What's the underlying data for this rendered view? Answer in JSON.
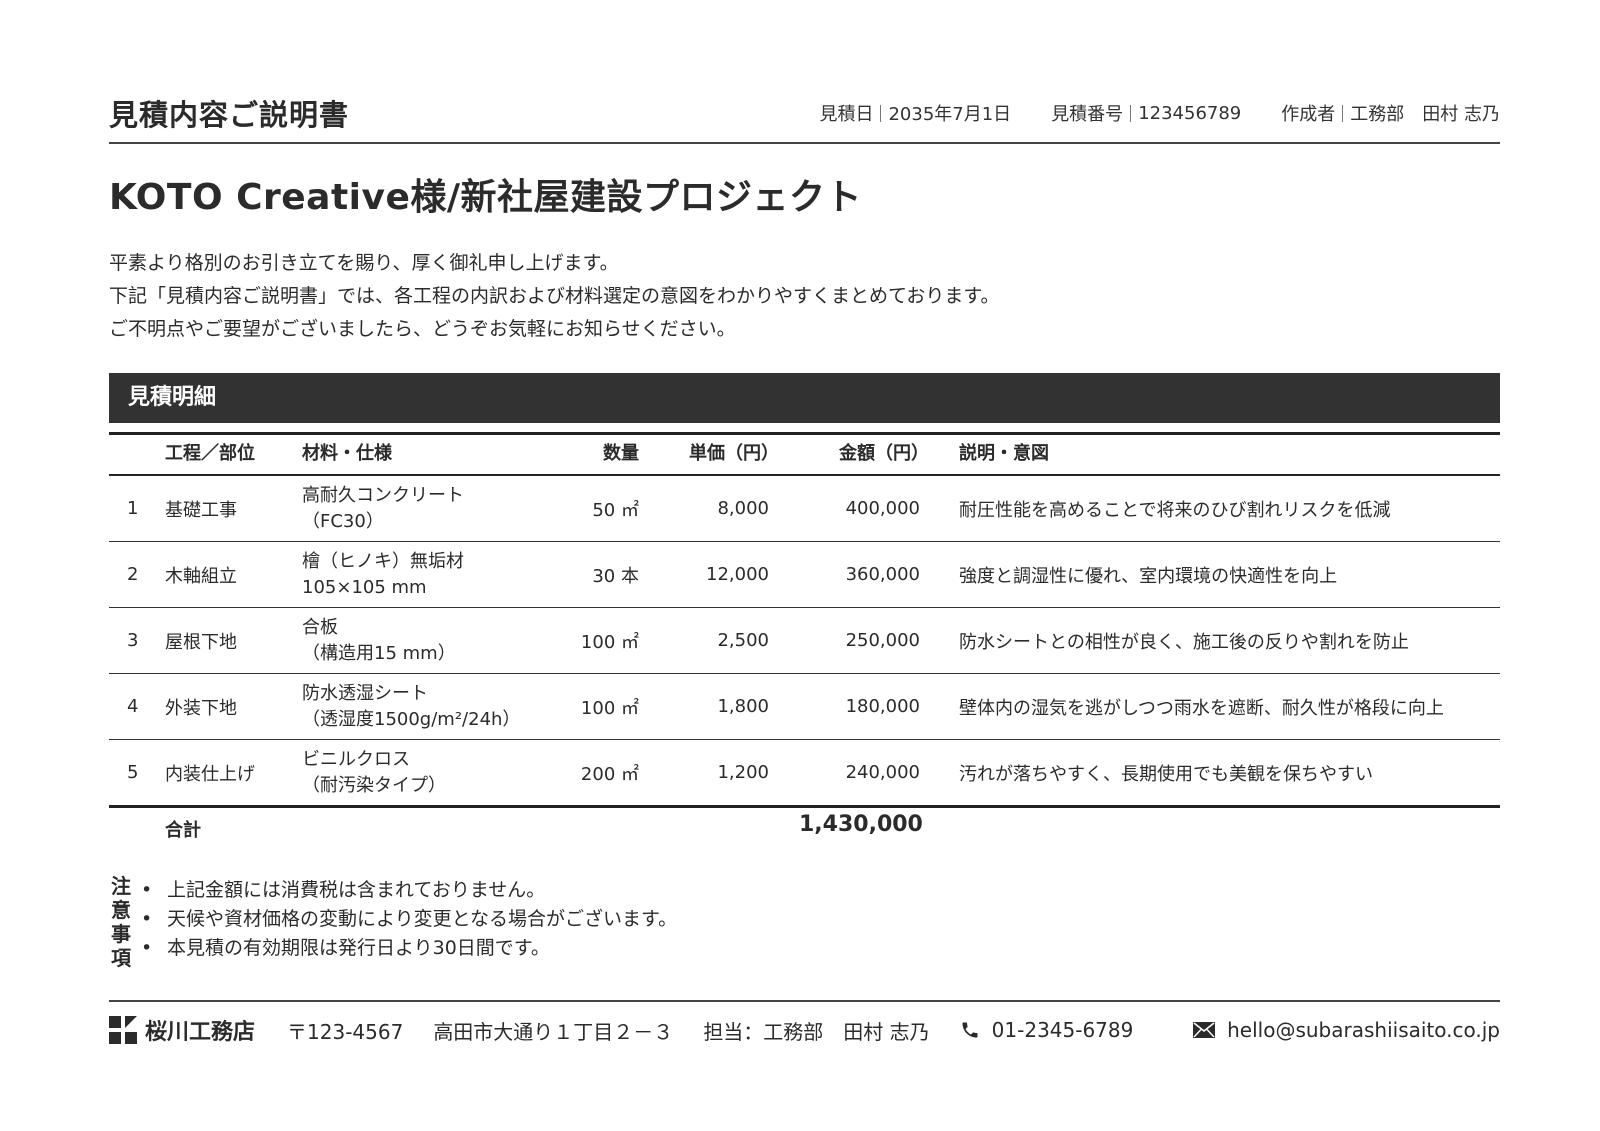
{
  "header": {
    "title": "見積内容ご説明書",
    "meta": [
      {
        "label": "見積日",
        "value": "2035年7月1日"
      },
      {
        "label": "見積番号",
        "value": "123456789"
      },
      {
        "label": "作成者",
        "value": "工務部　田村 志乃"
      }
    ]
  },
  "project_title": "KOTO Creative様/新社屋建設プロジェクト",
  "intro": [
    "平素より格別のお引き立てを賜り、厚く御礼申し上げます。",
    "下記「見積内容ご説明書」では、各工程の内訳および材料選定の意図をわかりやすくまとめております。",
    "ご不明点やご要望がございましたら、どうぞお気軽にお知らせください。"
  ],
  "section_title": "見積明細",
  "table": {
    "headers": {
      "process": "工程／部位",
      "material": "材料・仕様",
      "qty": "数量",
      "unit_price": "単価（円）",
      "amount": "金額（円）",
      "description": "説明・意図"
    },
    "rows": [
      {
        "no": "1",
        "process": "基礎工事",
        "material1": "高耐久コンクリート",
        "material2": "（FC30）",
        "qty": "50 ㎡",
        "unit_price": "8,000",
        "amount": "400,000",
        "description": "耐圧性能を高めることで将来のひび割れリスクを低減"
      },
      {
        "no": "2",
        "process": "木軸組立",
        "material1": "檜（ヒノキ）無垢材",
        "material2": " 105×105 mm",
        "qty": "30 本",
        "unit_price": "12,000",
        "amount": "360,000",
        "description": "強度と調湿性に優れ、室内環境の快適性を向上"
      },
      {
        "no": "3",
        "process": "屋根下地",
        "material1": "合板",
        "material2": "（構造用15 mm）",
        "qty": "100 ㎡",
        "unit_price": "2,500",
        "amount": "250,000",
        "description": "防水シートとの相性が良く、施工後の反りや割れを防止"
      },
      {
        "no": "4",
        "process": "外装下地",
        "material1": "防水透湿シート",
        "material2": "（透湿度1500g/m²/24h）",
        "qty": "100 ㎡",
        "unit_price": "1,800",
        "amount": "180,000",
        "description": "壁体内の湿気を逃がしつつ雨水を遮断、耐久性が格段に向上"
      },
      {
        "no": "5",
        "process": "内装仕上げ",
        "material1": "ビニルクロス",
        "material2": "（耐汚染タイプ）",
        "qty": "200 ㎡",
        "unit_price": "1,200",
        "amount": "240,000",
        "description": "汚れが落ちやすく、長期使用でも美観を保ちやすい"
      }
    ],
    "total_label": "合計",
    "total_amount": "1,430,000"
  },
  "notes": {
    "label": [
      "注",
      "意",
      "事",
      "項"
    ],
    "items": [
      "上記金額には消費税は含まれておりません。",
      "天候や資材価格の変動により変更となる場合がございます。",
      "本見積の有効期限は発行日より30日間です。"
    ]
  },
  "footer": {
    "company": "桜川工務店",
    "postal": "〒123-4567",
    "address": "高田市大通り１丁目２－３",
    "contact": "担当：工務部　田村 志乃",
    "phone": "01-2345-6789",
    "email": "hello@subarashiisaito.co.jp",
    "icons": {
      "logo": "logo-icon",
      "phone": "phone-icon",
      "email": "mail-icon"
    }
  },
  "colors": {
    "section_bar": "#323232",
    "text": "#2b2b2b",
    "page": "#ffffff"
  }
}
